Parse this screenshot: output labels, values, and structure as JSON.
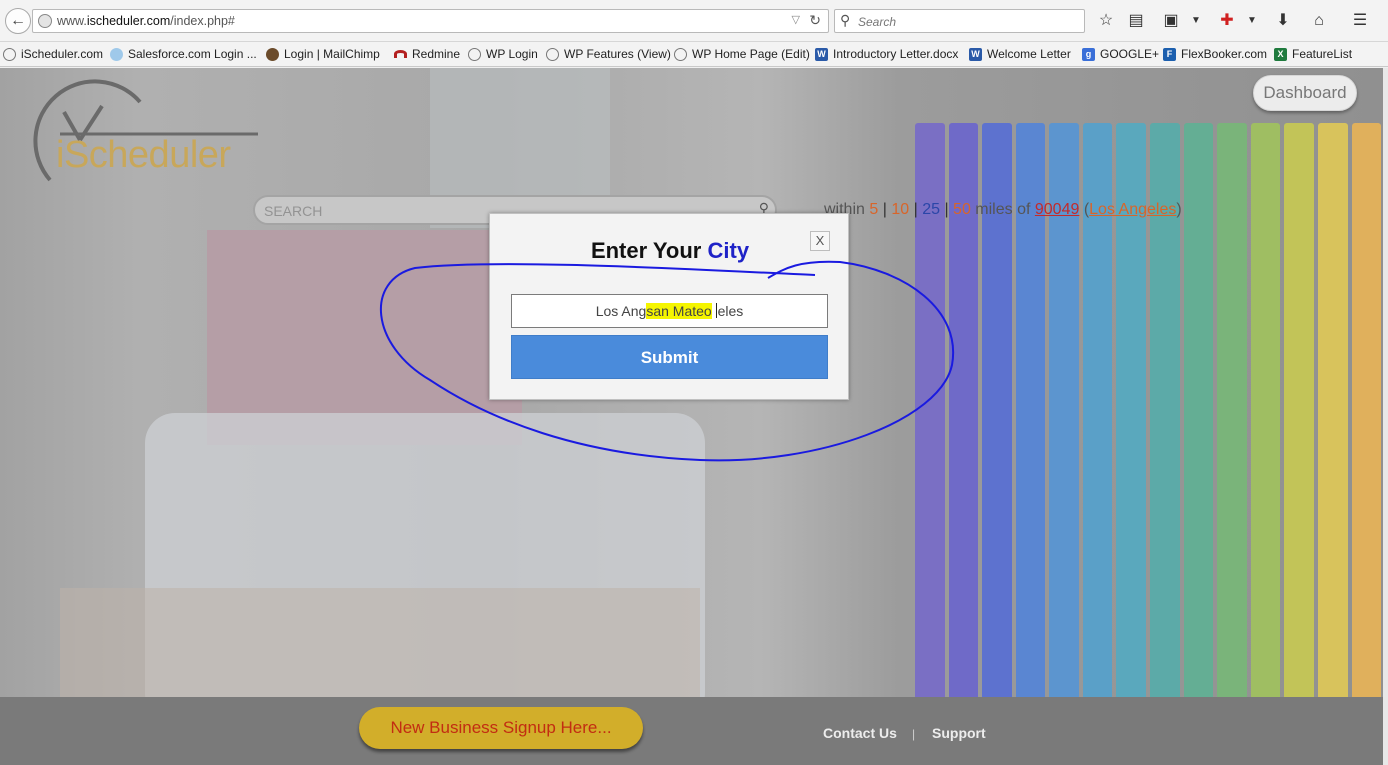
{
  "browser": {
    "url_prefix": "www.",
    "url_domain": "ischeduler.com",
    "url_path": "/index.php#",
    "search_placeholder": "Search"
  },
  "bookmarks": [
    {
      "label": "iScheduler.com",
      "icon": "ischeduler-icon",
      "color": "#ffffff"
    },
    {
      "label": "Salesforce.com Login ...",
      "icon": "salesforce-icon",
      "color": "#9fc9ea"
    },
    {
      "label": "Login | MailChimp",
      "icon": "mailchimp-icon",
      "color": "#6b4b2a"
    },
    {
      "label": "Redmine",
      "icon": "redmine-icon",
      "color": "#b32020"
    },
    {
      "label": "WP Login",
      "icon": "wordpress-icon",
      "color": "#ffffff"
    },
    {
      "label": "WP Features (View)",
      "icon": "wordpress-icon",
      "color": "#ffffff"
    },
    {
      "label": "WP Home Page (Edit)",
      "icon": "wordpress-icon",
      "color": "#ffffff"
    },
    {
      "label": "Introductory Letter.docx",
      "icon": "word-icon",
      "color": "#2a5aa8"
    },
    {
      "label": "Welcome Letter",
      "icon": "word-icon",
      "color": "#2a5aa8"
    },
    {
      "label": "GOOGLE+",
      "icon": "google-icon",
      "color": "#3a6fd8"
    },
    {
      "label": "FlexBooker.com",
      "icon": "flexbooker-icon",
      "color": "#1c5fae"
    },
    {
      "label": "FeatureList",
      "icon": "excel-icon",
      "color": "#1f7a3d"
    }
  ],
  "site": {
    "logo_text": "iScheduler",
    "dashboard_label": "Dashboard",
    "search_placeholder": "SEARCH",
    "within_label": "within",
    "radius_options": [
      "5",
      "10",
      "25",
      "50"
    ],
    "miles_of_label": "miles of",
    "zip": "90049",
    "city_link": "Los Angeles"
  },
  "modal": {
    "title_prefix": "Enter Your",
    "title_highlight": "City",
    "close_label": "X",
    "input_text_before": "Los Ang",
    "input_text_highlight": "san Mateo",
    "input_text_after": "eles",
    "submit_label": "Submit"
  },
  "footer": {
    "signup_label": "New Business Signup Here...",
    "contact_label": "Contact Us",
    "separator": "|",
    "support_label": "Support"
  },
  "colors": {
    "accent_blue": "#4a8bdb",
    "logo_gold": "#c8a75a",
    "annotation_blue": "#1a1ae0",
    "highlight_yellow": "#f5f500"
  }
}
